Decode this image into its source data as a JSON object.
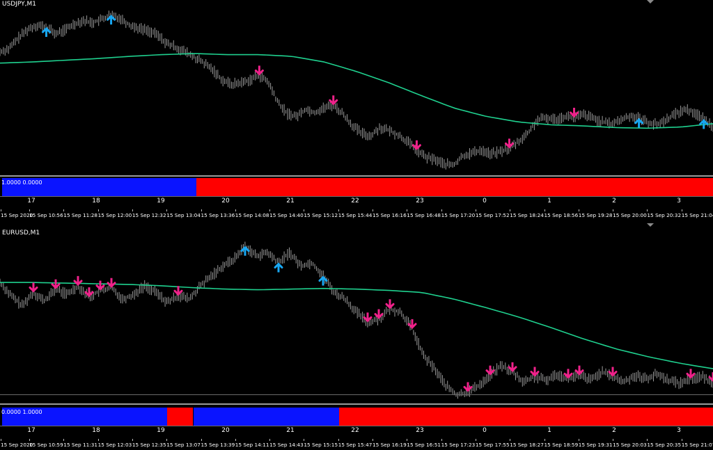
{
  "pane1": {
    "symbol": "USDJPY,M1",
    "indicator_values": "1.0000 0.0000",
    "indicator_segments": [
      {
        "state": "up",
        "from_hour": 16.55,
        "to_hour": 19.55
      },
      {
        "state": "down",
        "from_hour": 19.55,
        "to_hour": 27.55
      }
    ],
    "hour_labels": [
      "17",
      "18",
      "19",
      "20",
      "21",
      "22",
      "23",
      "0",
      "1",
      "2",
      "3"
    ],
    "time_labels": [
      "15 Sep 2020",
      "15 Sep 10:56",
      "15 Sep 11:28",
      "15 Sep 12:00",
      "15 Sep 12:32",
      "15 Sep 13:04",
      "15 Sep 13:36",
      "15 Sep 14:08",
      "15 Sep 14:40",
      "15 Sep 15:12",
      "15 Sep 15:44",
      "15 Sep 16:16",
      "15 Sep 16:48",
      "15 Sep 17:20",
      "15 Sep 17:52",
      "15 Sep 18:24",
      "15 Sep 18:56",
      "15 Sep 19:28",
      "15 Sep 20:00",
      "15 Sep 20:32",
      "15 Sep 21:04"
    ],
    "price": [
      0.3,
      0.36,
      0.55,
      0.7,
      0.78,
      0.74,
      0.62,
      0.69,
      0.8,
      0.86,
      0.82,
      0.88,
      0.96,
      0.9,
      0.78,
      0.72,
      0.68,
      0.6,
      0.45,
      0.38,
      0.3,
      0.2,
      0.1,
      -0.02,
      -0.2,
      -0.28,
      -0.25,
      -0.2,
      -0.12,
      -0.25,
      -0.6,
      -0.8,
      -0.85,
      -0.72,
      -0.78,
      -0.7,
      -0.65,
      -0.8,
      -1.0,
      -1.15,
      -1.2,
      -1.05,
      -1.1,
      -1.18,
      -1.3,
      -1.45,
      -1.58,
      -1.62,
      -1.7,
      -1.72,
      -1.55,
      -1.5,
      -1.45,
      -1.52,
      -1.48,
      -1.42,
      -1.3,
      -1.15,
      -0.92,
      -0.88,
      -0.9,
      -0.85,
      -0.87,
      -0.82,
      -0.88,
      -0.95,
      -0.98,
      -0.92,
      -0.84,
      -0.88,
      -0.96,
      -1.0,
      -0.9,
      -0.8,
      -0.72,
      -0.78,
      -0.9,
      -1.02
    ],
    "ma": [
      0.1,
      0.12,
      0.15,
      0.18,
      0.22,
      0.25,
      0.27,
      0.25,
      0.25,
      0.22,
      0.12,
      -0.05,
      -0.25,
      -0.48,
      -0.7,
      -0.85,
      -0.95,
      -1.0,
      -1.02,
      -1.05,
      -1.06,
      -1.04,
      -0.98
    ],
    "y_range": [
      -1.8,
      1.05
    ],
    "arrows": [
      {
        "dir": "up",
        "idx": 5
      },
      {
        "dir": "up",
        "idx": 12
      },
      {
        "dir": "down",
        "idx": 28
      },
      {
        "dir": "down",
        "idx": 36
      },
      {
        "dir": "down",
        "idx": 45
      },
      {
        "dir": "down",
        "idx": 55
      },
      {
        "dir": "down",
        "idx": 62
      },
      {
        "dir": "up",
        "idx": 69
      },
      {
        "dir": "up",
        "idx": 76
      }
    ]
  },
  "pane2": {
    "symbol": "EURUSD,M1",
    "indicator_values": "0.0000 1.0000",
    "indicator_segments": [
      {
        "state": "up",
        "from_hour": 16.55,
        "to_hour": 19.1
      },
      {
        "state": "down",
        "from_hour": 19.1,
        "to_hour": 19.5
      },
      {
        "state": "up",
        "from_hour": 19.5,
        "to_hour": 21.75
      },
      {
        "state": "down",
        "from_hour": 21.75,
        "to_hour": 27.55
      }
    ],
    "hour_labels": [
      "17",
      "18",
      "19",
      "20",
      "21",
      "22",
      "23",
      "0",
      "1",
      "2",
      "3"
    ],
    "time_labels": [
      "15 Sep 2020",
      "15 Sep 10:59",
      "15 Sep 11:31",
      "15 Sep 12:03",
      "15 Sep 12:35",
      "15 Sep 13:07",
      "15 Sep 13:39",
      "15 Sep 14:11",
      "15 Sep 14:43",
      "15 Sep 15:15",
      "15 Sep 15:47",
      "15 Sep 16:19",
      "15 Sep 16:51",
      "15 Sep 17:23",
      "15 Sep 17:55",
      "15 Sep 18:27",
      "15 Sep 18:59",
      "15 Sep 19:31",
      "15 Sep 20:03",
      "15 Sep 20:35",
      "15 Sep 21:07"
    ],
    "price": [
      0.0,
      -0.2,
      -0.35,
      -0.15,
      -0.28,
      -0.1,
      -0.18,
      -0.05,
      -0.22,
      -0.12,
      -0.08,
      -0.25,
      -0.18,
      -0.05,
      -0.15,
      -0.3,
      -0.2,
      -0.25,
      -0.05,
      0.1,
      0.25,
      0.35,
      0.55,
      0.4,
      0.45,
      0.3,
      0.45,
      0.25,
      0.3,
      0.1,
      -0.15,
      -0.25,
      -0.45,
      -0.6,
      -0.55,
      -0.4,
      -0.45,
      -0.7,
      -1.1,
      -1.3,
      -1.55,
      -1.7,
      -1.65,
      -1.55,
      -1.4,
      -1.25,
      -1.35,
      -1.5,
      -1.42,
      -1.48,
      -1.38,
      -1.45,
      -1.4,
      -1.47,
      -1.35,
      -1.42,
      -1.5,
      -1.4,
      -1.45,
      -1.38,
      -1.47,
      -1.52,
      -1.45,
      -1.42,
      -1.5
    ],
    "ma": [
      0.0,
      0.0,
      -0.01,
      -0.02,
      -0.03,
      -0.05,
      -0.08,
      -0.1,
      -0.11,
      -0.1,
      -0.09,
      -0.1,
      -0.12,
      -0.15,
      -0.25,
      -0.38,
      -0.52,
      -0.68,
      -0.85,
      -1.0,
      -1.12,
      -1.22,
      -1.3
    ],
    "y_range": [
      -1.75,
      0.62
    ],
    "arrows": [
      {
        "dir": "down",
        "idx": 3
      },
      {
        "dir": "down",
        "idx": 5
      },
      {
        "dir": "down",
        "idx": 7
      },
      {
        "dir": "down",
        "idx": 8
      },
      {
        "dir": "down",
        "idx": 9
      },
      {
        "dir": "down",
        "idx": 10
      },
      {
        "dir": "down",
        "idx": 16
      },
      {
        "dir": "up",
        "idx": 22
      },
      {
        "dir": "up",
        "idx": 25
      },
      {
        "dir": "up",
        "idx": 29
      },
      {
        "dir": "down",
        "idx": 33
      },
      {
        "dir": "down",
        "idx": 34
      },
      {
        "dir": "down",
        "idx": 35
      },
      {
        "dir": "down",
        "idx": 37
      },
      {
        "dir": "down",
        "idx": 42
      },
      {
        "dir": "down",
        "idx": 44
      },
      {
        "dir": "down",
        "idx": 46
      },
      {
        "dir": "down",
        "idx": 48
      },
      {
        "dir": "down",
        "idx": 51
      },
      {
        "dir": "down",
        "idx": 52
      },
      {
        "dir": "down",
        "idx": 55
      },
      {
        "dir": "down",
        "idx": 62
      },
      {
        "dir": "down",
        "idx": 64
      }
    ]
  },
  "colors": {
    "background": "#000000",
    "price": "#9c9c9c",
    "ma": "#1fd18f",
    "arrow_up": "#18a7f2",
    "arrow_down": "#f0218a",
    "ind_up": "#0a14ff",
    "ind_down": "#ff0000"
  },
  "icons": {
    "arrow_up": "up-arrow-icon",
    "arrow_down": "down-arrow-icon",
    "scroll_marker": "triangle-down-icon"
  }
}
